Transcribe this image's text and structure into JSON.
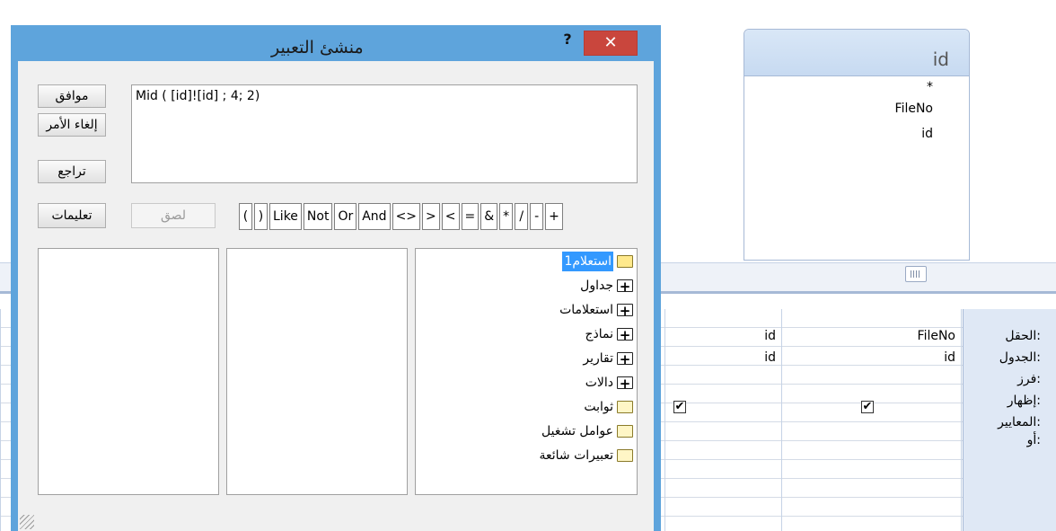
{
  "background": {
    "table_box": {
      "title": "id",
      "fields": [
        "*",
        "FileNo",
        "id"
      ]
    },
    "grid": {
      "row_labels": [
        "الحقل:",
        "الجدول:",
        "فرز:",
        "إظهار:",
        "المعايير:",
        "أو:"
      ],
      "columns": [
        {
          "field": "FileNo",
          "table": "id",
          "show": "✔"
        },
        {
          "field": "id",
          "table": "id",
          "show": "✔"
        }
      ]
    }
  },
  "dialog": {
    "title": "منشئ التعبير",
    "help_label": "?",
    "close_label": "✕",
    "buttons": {
      "ok": "موافق",
      "cancel": "إلغاء الأمر",
      "undo": "تراجع",
      "help": "تعليمات",
      "paste": "لصق"
    },
    "expression": "Mid ( [id]![id]  ; 4; 2)",
    "operators": [
      "(",
      ")",
      "Like",
      "Not",
      "Or",
      "And",
      "<>",
      ">",
      "<",
      "=",
      "&",
      "*",
      "/",
      "-",
      "+"
    ],
    "tree": [
      {
        "label": "استعلام1",
        "icon": "open-folder-icon",
        "selected": true
      },
      {
        "label": "جداول",
        "icon": "plus-folder-icon"
      },
      {
        "label": "استعلامات",
        "icon": "plus-folder-icon"
      },
      {
        "label": "نماذج",
        "icon": "plus-folder-icon"
      },
      {
        "label": "تقارير",
        "icon": "plus-folder-icon"
      },
      {
        "label": "دالات",
        "icon": "plus-folder-icon"
      },
      {
        "label": "ثوابت",
        "icon": "folder-icon"
      },
      {
        "label": "عوامل تشغيل",
        "icon": "folder-icon"
      },
      {
        "label": "تعبيرات شائعة",
        "icon": "folder-icon"
      }
    ]
  }
}
